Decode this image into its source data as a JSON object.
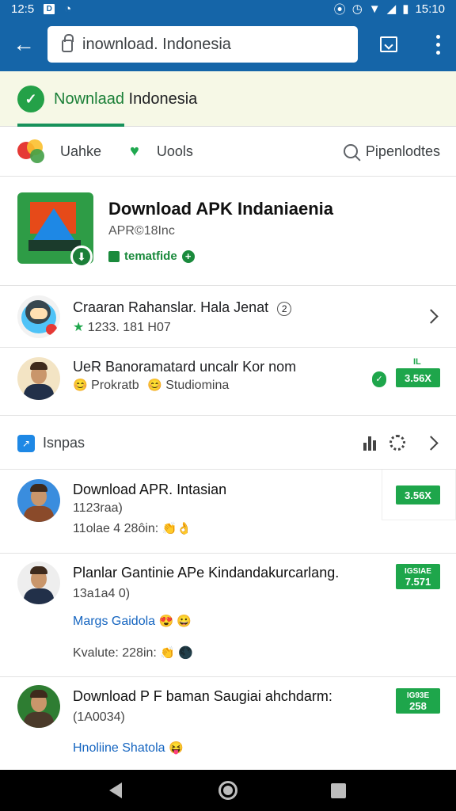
{
  "status_bar": {
    "time_left": "12:5",
    "time_right": "15:10",
    "left_box_glyph": "D"
  },
  "browser": {
    "url": "inownload. Indonesia"
  },
  "site": {
    "brand_part1": "Nownlaad",
    "brand_part2": "Indonesia",
    "nav": {
      "item1": "Uahke",
      "item2": "Uools",
      "search_label": "Pipenlodtes"
    }
  },
  "app": {
    "title": "Download APK Indaniaenia",
    "subtitle": "APR©18Inc",
    "tag": "tematfide"
  },
  "rows": [
    {
      "title": "Craaran Rahanslar. Hala Jenat",
      "rating_line": "1233. 181 H07"
    },
    {
      "title": "UeR Banoramatard uncalr Kor nom",
      "sub1": "Prokratb",
      "sub2": "Studiomina",
      "badge_small": "IL",
      "price": "3.56X"
    }
  ],
  "section": {
    "title": "Isnpas"
  },
  "list": [
    {
      "title": "Download APR. Intasian",
      "line2": "1123raa)",
      "line3": "11olae 4 28ôin:",
      "price": "3.56X"
    },
    {
      "title": "Planlar Gantinie APe Kindandakurcarlang.",
      "line2": "13a1a4 0)",
      "link": "Margs Gaidola",
      "line4": "Kvalute: 228in:",
      "price_top": "IGSIAE",
      "price": "7.571"
    },
    {
      "title": "Download P F baman Saugiai ahchdarm:",
      "line2": "(1A0034)",
      "link": "Hnoliine Shatola",
      "price_top": "IG93E",
      "price": "258"
    }
  ],
  "colors": {
    "toolbar_blue": "#1565a8",
    "brand_green": "#17925b",
    "price_green": "#1ea64b",
    "link_blue": "#1565c0"
  }
}
